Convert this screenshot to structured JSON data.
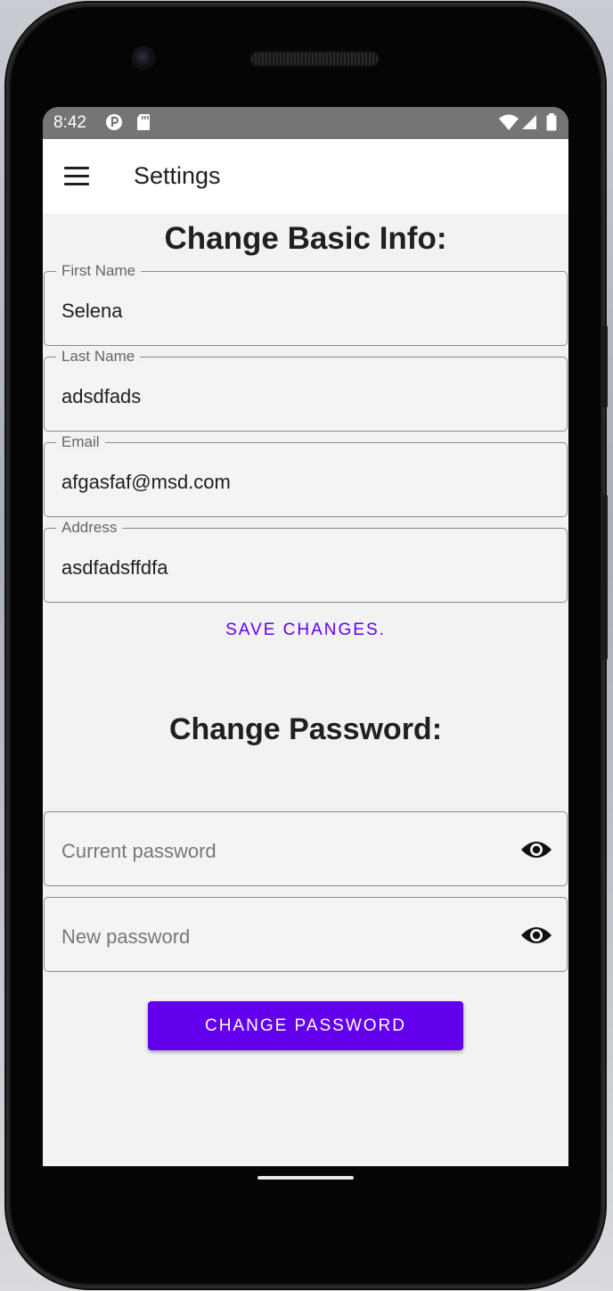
{
  "status_bar": {
    "time": "8:42"
  },
  "app_bar": {
    "title": "Settings",
    "menu_icon": "hamburger-menu-icon"
  },
  "basic_info": {
    "title": "Change Basic Info:",
    "fields": [
      {
        "label": "First Name",
        "value": "Selena"
      },
      {
        "label": "Last Name",
        "value": "adsdfads"
      },
      {
        "label": "Email",
        "value": "afgasfaf@msd.com"
      },
      {
        "label": "Address",
        "value": "asdfadsffdfa"
      }
    ],
    "save_label": "SAVE CHANGES."
  },
  "password": {
    "title": "Change Password:",
    "current_placeholder": "Current password",
    "new_placeholder": "New password",
    "toggle_icon": "eye-icon",
    "button_label": "CHANGE PASSWORD"
  },
  "colors": {
    "accent": "#6200ee",
    "status_bar": "#757575",
    "background": "#f2f2f2"
  }
}
